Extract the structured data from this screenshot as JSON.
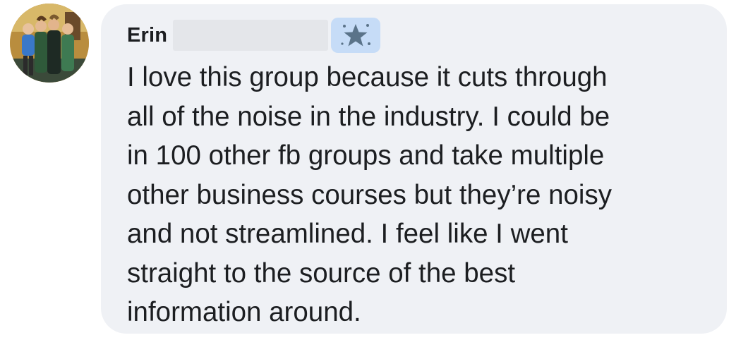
{
  "comment": {
    "author": "Erin",
    "badge_icon": "star-badge-icon",
    "text": "I love this group because it cuts through\nall of the noise in the industry. I could be\nin 100 other fb groups and take multiple\nother business courses but they’re noisy\nand not streamlined. I feel like I went\nstraight to the source of the best\ninformation around."
  },
  "colors": {
    "bubble_background": "#eff1f5",
    "badge_background": "#c6dcf7",
    "badge_star": "#5a7389",
    "text": "#1c1e21"
  }
}
